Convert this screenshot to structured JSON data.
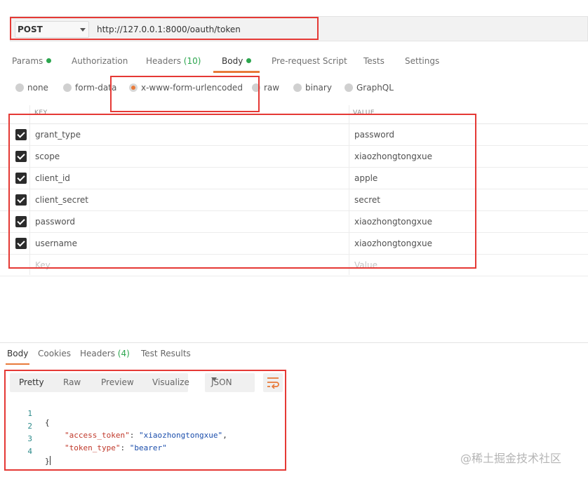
{
  "request": {
    "method": "POST",
    "url": "http://127.0.0.1:8000/oauth/token"
  },
  "request_tabs": [
    {
      "label": "Params",
      "indicator": "dot",
      "count": ""
    },
    {
      "label": "Authorization",
      "count": ""
    },
    {
      "label": "Headers",
      "count": "(10)"
    },
    {
      "label": "Body",
      "indicator": "dot",
      "count": "",
      "active": true
    },
    {
      "label": "Pre-request Script",
      "count": ""
    },
    {
      "label": "Tests",
      "count": ""
    },
    {
      "label": "Settings",
      "count": ""
    }
  ],
  "body_types": [
    {
      "label": "none"
    },
    {
      "label": "form-data"
    },
    {
      "label": "x-www-form-urlencoded",
      "selected": true
    },
    {
      "label": "raw"
    },
    {
      "label": "binary"
    },
    {
      "label": "GraphQL"
    }
  ],
  "params_table": {
    "key_header": "KEY",
    "value_header": "VALUE",
    "rows": [
      {
        "checked": true,
        "key": "grant_type",
        "value": "password"
      },
      {
        "checked": true,
        "key": "scope",
        "value": "xiaozhongtongxue"
      },
      {
        "checked": true,
        "key": "client_id",
        "value": "apple"
      },
      {
        "checked": true,
        "key": "client_secret",
        "value": "secret"
      },
      {
        "checked": true,
        "key": "password",
        "value": "xiaozhongtongxue"
      },
      {
        "checked": true,
        "key": "username",
        "value": "xiaozhongtongxue"
      }
    ],
    "key_placeholder": "Key",
    "value_placeholder": "Value"
  },
  "response_tabs": [
    {
      "label": "Body",
      "count": "",
      "active": true
    },
    {
      "label": "Cookies",
      "count": ""
    },
    {
      "label": "Headers",
      "count": "(4)"
    },
    {
      "label": "Test Results",
      "count": ""
    }
  ],
  "view_modes": [
    "Pretty",
    "Raw",
    "Preview",
    "Visualize"
  ],
  "format": "JSON",
  "response_code": [
    {
      "n": "1",
      "text": "{"
    },
    {
      "n": "2",
      "key": "\"access_token\"",
      "value": "\"xiaozhongtongxue\"",
      "trail": ","
    },
    {
      "n": "3",
      "key": "\"token_type\"",
      "value": "\"bearer\"",
      "trail": ""
    },
    {
      "n": "4",
      "text": "}"
    }
  ],
  "watermark": "@稀土掘金技术社区",
  "colors": {
    "accent": "#e87a3a",
    "green": "#2ca64e",
    "annotation": "#e53935"
  }
}
